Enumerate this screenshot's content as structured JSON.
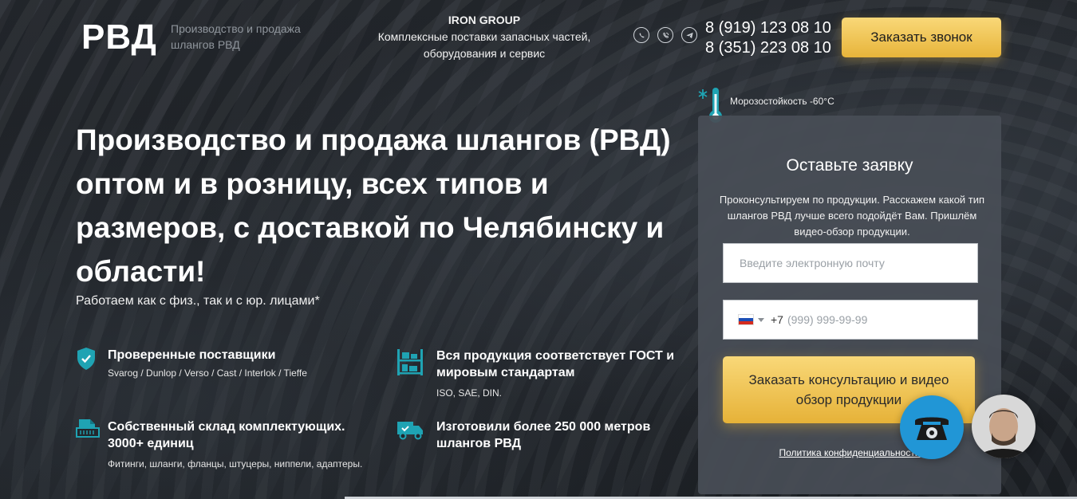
{
  "header": {
    "logo": "РВД",
    "tagline": "Производство и продажа шлангов РВД",
    "group_name": "IRON GROUP",
    "group_desc": "Комплексные поставки запасных частей, оборудования и сервис",
    "messengers": [
      "whatsapp-icon",
      "viber-icon",
      "telegram-icon"
    ],
    "phone1": "8 (919) 123 08 10",
    "phone2": "8 (351) 223 08 10",
    "call_button": "Заказать звонок"
  },
  "hero": {
    "title": "Производство и продажа шлангов (РВД) оптом и в розницу, всех типов и размеров, с доставкой по Челябинску и области!",
    "subtitle": "Работаем как с физ., так и с юр. лицами*"
  },
  "features": [
    {
      "icon": "shield-check-icon",
      "title": "Проверенные поставщики",
      "desc": "Svarog / Dunlop / Verso / Cast / Interlok / Tieffe"
    },
    {
      "icon": "warehouse-rack-icon",
      "title": "Вся продукция соответствует ГОСТ и мировым стандартам",
      "desc": "ISO, SAE, DIN."
    },
    {
      "icon": "document-box-icon",
      "title": "Собственный склад комплектующих. 3000+ единиц",
      "desc": "Фитинги, шланги, фланцы, штуцеры, ниппели, адаптеры."
    },
    {
      "icon": "delivery-truck-icon",
      "title": "Изготовили более 250 000 метров шлангов РВД",
      "desc": ""
    }
  ],
  "freeze_note": "Морозостойкость -60°C",
  "form": {
    "title": "Оставьте заявку",
    "text": "Проконсультируем по продукции. Расскажем какой тип шлангов РВД лучше всего подойдёт Вам. Пришлём видео-обзор продукции.",
    "email_placeholder": "Введите электронную почту",
    "dial_code": "+7",
    "phone_placeholder": "(999) 999-99-99",
    "submit": "Заказать консультацию и видео обзор продукции",
    "privacy": "Политика конфиденциальности"
  },
  "colors": {
    "accent": "#f2c24f",
    "teal_icon": "#1fa3b3",
    "panel": "#484e56",
    "widget_blue": "#2196d6"
  }
}
